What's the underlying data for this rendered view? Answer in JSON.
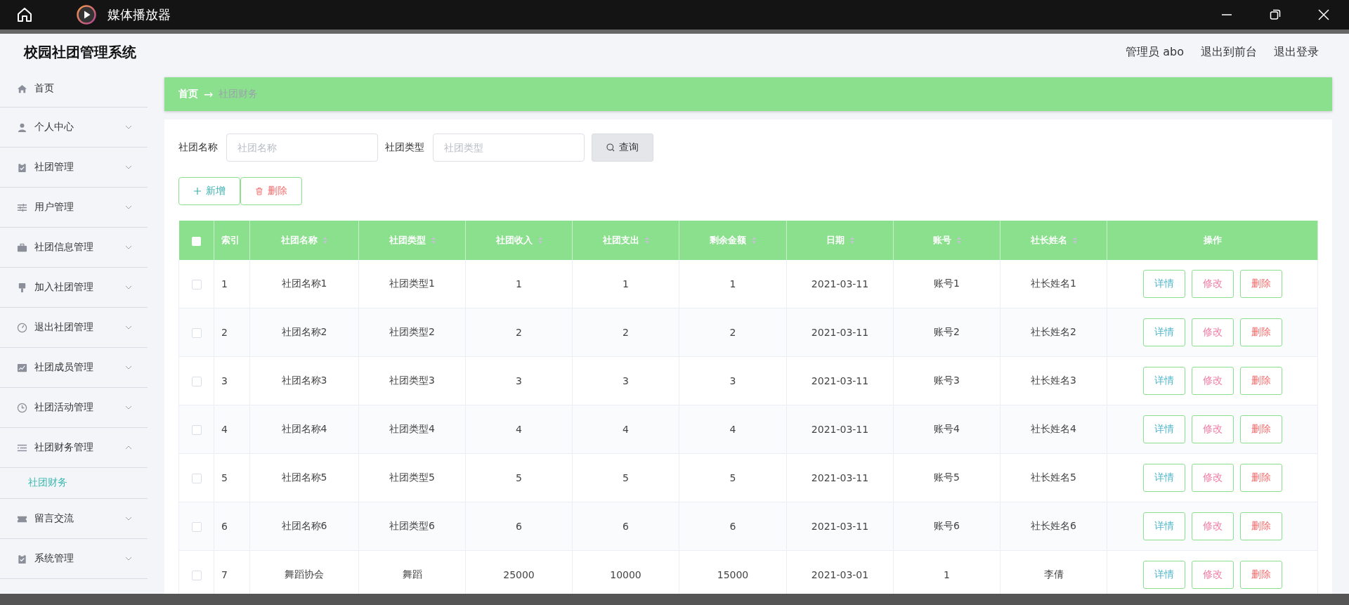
{
  "window": {
    "title": "媒体播放器"
  },
  "header": {
    "title": "校园社团管理系统",
    "links": [
      "管理员 abo",
      "退出到前台",
      "退出登录"
    ]
  },
  "sidebar": {
    "items": [
      {
        "label": "首页"
      },
      {
        "label": "个人中心",
        "expanded": false
      },
      {
        "label": "社团管理",
        "expanded": false
      },
      {
        "label": "用户管理",
        "expanded": false
      },
      {
        "label": "社团信息管理",
        "expanded": false
      },
      {
        "label": "加入社团管理",
        "expanded": false
      },
      {
        "label": "退出社团管理",
        "expanded": false
      },
      {
        "label": "社团成员管理",
        "expanded": false
      },
      {
        "label": "社团活动管理",
        "expanded": false
      },
      {
        "label": "社团财务管理",
        "expanded": true,
        "children": [
          {
            "label": "社团财务",
            "selected": true
          }
        ]
      },
      {
        "label": "留言交流",
        "expanded": false
      },
      {
        "label": "系统管理",
        "expanded": false
      }
    ]
  },
  "breadcrumb": {
    "home": "首页",
    "separator": "→",
    "current": "社团财务"
  },
  "search": {
    "fields": [
      {
        "label": "社团名称",
        "placeholder": "社团名称"
      },
      {
        "label": "社团类型",
        "placeholder": "社团类型"
      }
    ],
    "button": "查询"
  },
  "actions": {
    "add": "新增",
    "delete": "删除"
  },
  "table": {
    "select_all_checked": false,
    "columns": [
      {
        "label": "索引",
        "sortable": false
      },
      {
        "label": "社团名称",
        "sortable": true
      },
      {
        "label": "社团类型",
        "sortable": true
      },
      {
        "label": "社团收入",
        "sortable": true
      },
      {
        "label": "社团支出",
        "sortable": true
      },
      {
        "label": "剩余金额",
        "sortable": true
      },
      {
        "label": "日期",
        "sortable": true
      },
      {
        "label": "账号",
        "sortable": true
      },
      {
        "label": "社长姓名",
        "sortable": true
      },
      {
        "label": "操作",
        "sortable": false
      }
    ],
    "rows": [
      {
        "checked": false,
        "cells": [
          "1",
          "社团名称1",
          "社团类型1",
          "1",
          "1",
          "1",
          "2021-03-11",
          "账号1",
          "社长姓名1"
        ],
        "actions": [
          "详情",
          "修改",
          "删除"
        ]
      },
      {
        "checked": false,
        "cells": [
          "2",
          "社团名称2",
          "社团类型2",
          "2",
          "2",
          "2",
          "2021-03-11",
          "账号2",
          "社长姓名2"
        ],
        "actions": [
          "详情",
          "修改",
          "删除"
        ]
      },
      {
        "checked": false,
        "cells": [
          "3",
          "社团名称3",
          "社团类型3",
          "3",
          "3",
          "3",
          "2021-03-11",
          "账号3",
          "社长姓名3"
        ],
        "actions": [
          "详情",
          "修改",
          "删除"
        ]
      },
      {
        "checked": false,
        "cells": [
          "4",
          "社团名称4",
          "社团类型4",
          "4",
          "4",
          "4",
          "2021-03-11",
          "账号4",
          "社长姓名4"
        ],
        "actions": [
          "详情",
          "修改",
          "删除"
        ]
      },
      {
        "checked": false,
        "cells": [
          "5",
          "社团名称5",
          "社团类型5",
          "5",
          "5",
          "5",
          "2021-03-11",
          "账号5",
          "社长姓名5"
        ],
        "actions": [
          "详情",
          "修改",
          "删除"
        ]
      },
      {
        "checked": false,
        "cells": [
          "6",
          "社团名称6",
          "社团类型6",
          "6",
          "6",
          "6",
          "2021-03-11",
          "账号6",
          "社长姓名6"
        ],
        "actions": [
          "详情",
          "修改",
          "删除"
        ]
      },
      {
        "checked": false,
        "cells": [
          "7",
          "舞蹈协会",
          "舞蹈",
          "25000",
          "10000",
          "15000",
          "2021-03-01",
          "1",
          "李倩"
        ],
        "actions": [
          "详情",
          "修改",
          "删除"
        ]
      }
    ]
  }
}
